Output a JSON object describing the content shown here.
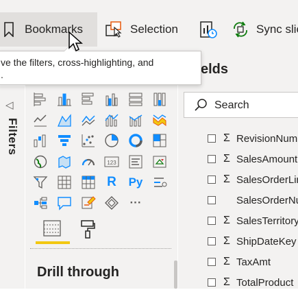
{
  "ribbon": {
    "bookmarks_label": "Bookmarks",
    "selection_label": "Selection",
    "sync_label": "Sync slic"
  },
  "tooltip": {
    "text": "ve the filters, cross-highlighting, and",
    "line2": "."
  },
  "filters": {
    "label": "Filters"
  },
  "fields": {
    "title": "elds",
    "search_placeholder": "Search",
    "items": [
      {
        "name": "RevisionNum",
        "sigma": true
      },
      {
        "name": "SalesAmount",
        "sigma": true
      },
      {
        "name": "SalesOrderLin",
        "sigma": true
      },
      {
        "name": "SalesOrderNu",
        "sigma": false
      },
      {
        "name": "SalesTerritory",
        "sigma": true
      },
      {
        "name": "ShipDateKey",
        "sigma": true
      },
      {
        "name": "TaxAmt",
        "sigma": true
      },
      {
        "name": "TotalProduct",
        "sigma": true
      }
    ]
  },
  "visualizations": {
    "drill_title": "Drill through",
    "icons": [
      "stacked-bar-icon",
      "stacked-column-icon",
      "clustered-bar-icon",
      "clustered-column-icon",
      "100-stacked-bar-icon",
      "100-stacked-column-icon",
      "line-chart-icon",
      "area-chart-icon",
      "stacked-area-icon",
      "line-stacked-column-icon",
      "line-clustered-column-icon",
      "ribbon-chart-icon",
      "waterfall-icon",
      "funnel-icon",
      "scatter-icon",
      "pie-icon",
      "donut-icon",
      "treemap-icon",
      "map-icon",
      "filled-map-icon",
      "gauge-icon",
      "card-icon",
      "multirow-card-icon",
      "kpi-icon",
      "slicer-icon",
      "table-icon",
      "matrix-icon",
      "r-visual-icon",
      "python-visual-icon",
      "key-influencers-icon",
      "decomposition-tree-icon",
      "qa-icon",
      "smart-narrative-icon",
      "custom-visual-icon",
      "more-visuals-icon"
    ],
    "r_label": "R",
    "py_label": "Py",
    "more_label": "···",
    "card_label": "123"
  },
  "colors": {
    "accent": "#f2c811",
    "blue": "#118dff",
    "panel": "#f3f2f1"
  }
}
